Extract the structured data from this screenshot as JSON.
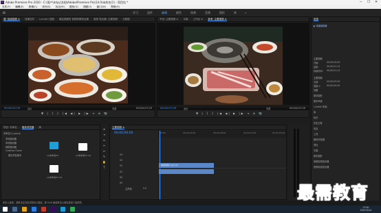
{
  "titlebar": {
    "title": "Adobe Premiere Pro 2020 - C:\\用户\\ddyy\\文档\\Adobe\\Premiere Pro\\14.0\\未命名(1) - 项目包 *",
    "minimize": "─",
    "maximize": "☐",
    "close": "✕"
  },
  "menubar": {
    "items": [
      "文件(F)",
      "编辑(E)",
      "剪辑(C)",
      "序列(S)",
      "标记(M)",
      "图形(G)",
      "视图(V)",
      "窗口(W)",
      "帮助(H)"
    ]
  },
  "workspace": {
    "home": "⌂",
    "tabs": [
      "学习",
      "组件",
      "编辑",
      "颜色",
      "效果",
      "音频",
      "图形",
      "库"
    ],
    "more": "»",
    "active_index": 2
  },
  "source_monitor": {
    "tabs": [
      "源: 前级视频 ≡",
      "效果控件",
      "Lumetri 范围",
      "源监视器的 音频剪辑混合器",
      "音频 混合器: 主要视频",
      "元数据"
    ],
    "timecode_left": "00;00;01;05",
    "fit": "适合",
    "full": "完整",
    "timecode_right": "00;00;07;25"
  },
  "program_monitor": {
    "tabs": [
      "节目: 主要视频 ≡",
      "字幕",
      "工作区 ≡",
      "参考: 主要视频 ≡"
    ],
    "timecode_left": "00;00;07;25",
    "fit": "适合",
    "full": "完整",
    "timecode_right": "00;00;07;25"
  },
  "right_panel": {
    "tabs": [
      "信息",
      "效果",
      "标记",
      "历史记录"
    ],
    "header": "信息",
    "section": "▶ 未选择剪辑",
    "rows": [
      {
        "label": "主要视频",
        "value": ""
      },
      {
        "label": "开始:",
        "value": "00;00;00;00"
      },
      {
        "label": "结束:",
        "value": "00;00;01;14"
      },
      {
        "label": "持续时间:",
        "value": "00;00;01;15"
      },
      {
        "label": "主要视频",
        "value": ""
      },
      {
        "label": "当前:",
        "value": "00;00;02;05"
      },
      {
        "label": "视频 1:",
        "value": "00;00;00;00"
      }
    ],
    "fx_list": [
      "效果",
      "基本图形",
      "基本声音",
      "Lumetri 颜色",
      "库",
      "标记",
      "历史记录",
      "信息",
      "工具",
      "媒体浏览器",
      "项目",
      "字幕",
      "基本图形",
      "音频剪辑混合器",
      "音频轨道混合器",
      "源监视器",
      "节目监视器",
      "时间码"
    ]
  },
  "project_panel": {
    "tabs": [
      "项目: 未命名",
      "媒体浏览器",
      "库",
      "信息",
      "效果",
      "标记"
    ],
    "path_label": "未命名(1).prproj",
    "tree": [
      "本地驱动器",
      "本地驱动器",
      "网络驱动器",
      "Creative Cloud",
      "团队项目版本"
    ],
    "items": [
      {
        "name": "(1)未命名03",
        "duration": ""
      },
      {
        "name": "(1)未命名03 (2)",
        "duration": ""
      },
      {
        "name": "(1)未命名03 (3)",
        "duration": ""
      }
    ]
  },
  "timeline": {
    "tab": "主要视频 ≡",
    "timecode": "00;00;00;00",
    "ruler": [
      "00;00",
      "00;00;04;00",
      "00;00;08;00",
      "00;00;12;00",
      "00;00;16;00"
    ],
    "video_tracks": [
      "V3",
      "V2",
      "V1"
    ],
    "audio_tracks": [
      "A1",
      "A2",
      "A3"
    ],
    "master": "主声道",
    "master_value": "0.0",
    "video_clip": "前级视频.mp4 [V]",
    "audio_clip": ""
  },
  "status_bar": {
    "text": "单击以选择，或单击空白处并拖动以框选。按 Shift 键和单击以增加或减少选择项。"
  },
  "taskbar": {
    "time": "17:00",
    "date": "2021/5/14"
  },
  "watermark": {
    "text": "最需教育"
  }
}
